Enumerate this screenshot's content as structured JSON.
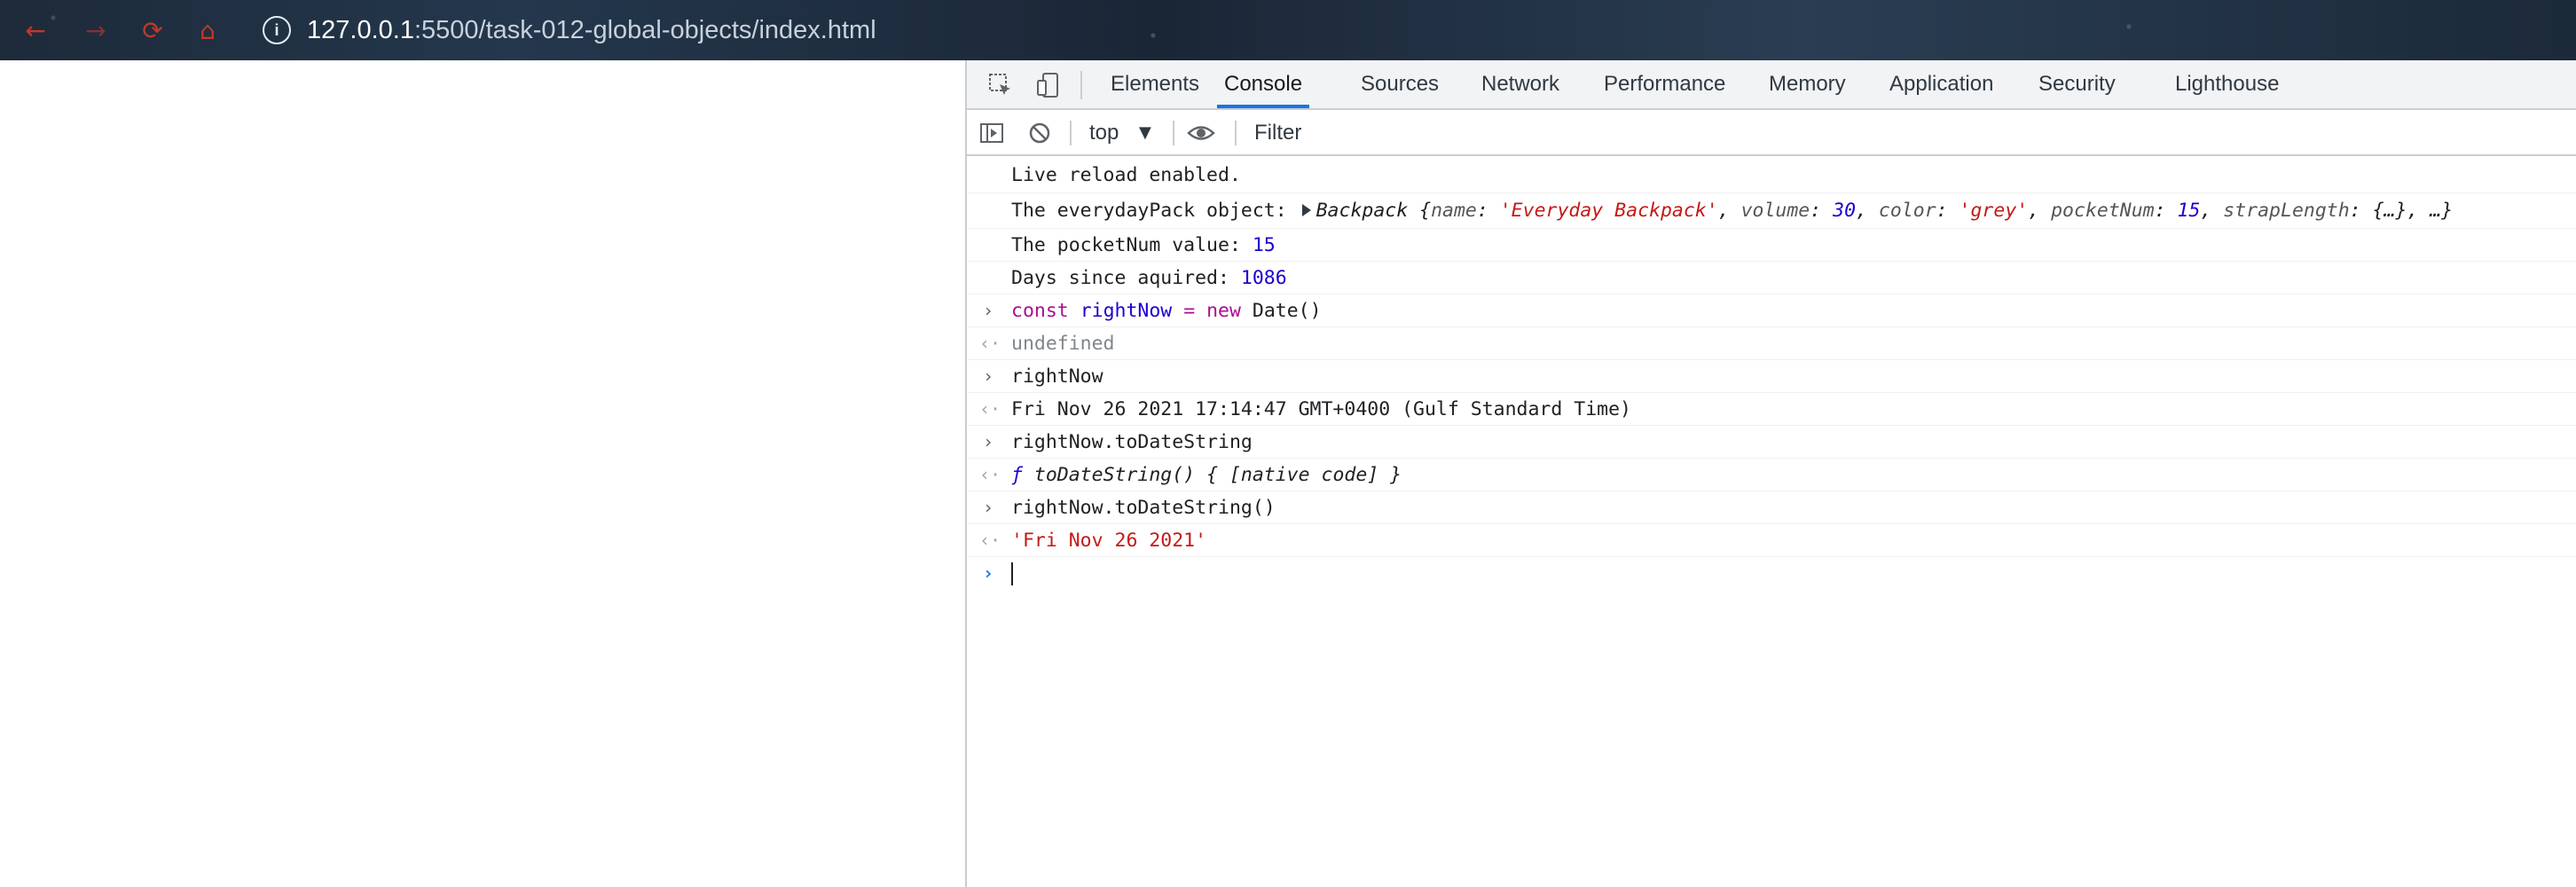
{
  "browser": {
    "url_host": "127.0.0.1",
    "url_path": ":5500/task-012-global-objects/index.html"
  },
  "devtools": {
    "tabs": [
      "Elements",
      "Console",
      "Sources",
      "Network",
      "Performance",
      "Memory",
      "Application",
      "Security",
      "Lighthouse"
    ],
    "active_tab": "Console",
    "context": "top",
    "filter_placeholder": "Filter"
  },
  "console": {
    "live_reload": "Live reload enabled.",
    "pack_label": "The everydayPack object: ",
    "pack_class": "Backpack",
    "pack_open": " {",
    "pack_k_name": "name",
    "pack_v_name": "'Everyday Backpack'",
    "pack_k_volume": "volume",
    "pack_v_volume": "30",
    "pack_k_color": "color",
    "pack_v_color": "'grey'",
    "pack_k_pocket": "pocketNum",
    "pack_v_pocket": "15",
    "pack_k_strap": "strapLength",
    "pack_v_strap": "{…}",
    "pack_tail": ", …}",
    "pocket_label": "The pocketNum value: ",
    "pocket_value": "15",
    "days_label": "Days since aquired: ",
    "days_value": "1086",
    "cmd1_const": "const",
    "cmd1_var": "rightNow",
    "cmd1_eq": "=",
    "cmd1_new": "new",
    "cmd1_rest": "Date()",
    "res1": "undefined",
    "cmd2": "rightNow",
    "res2": "Fri Nov 26 2021 17:14:47 GMT+0400 (Gulf Standard Time)",
    "cmd3": "rightNow.toDateString",
    "res3_f": "ƒ",
    "res3_body": "toDateString() { [native code] }",
    "cmd4": "rightNow.toDateString()",
    "res4": "'Fri Nov 26 2021'"
  }
}
